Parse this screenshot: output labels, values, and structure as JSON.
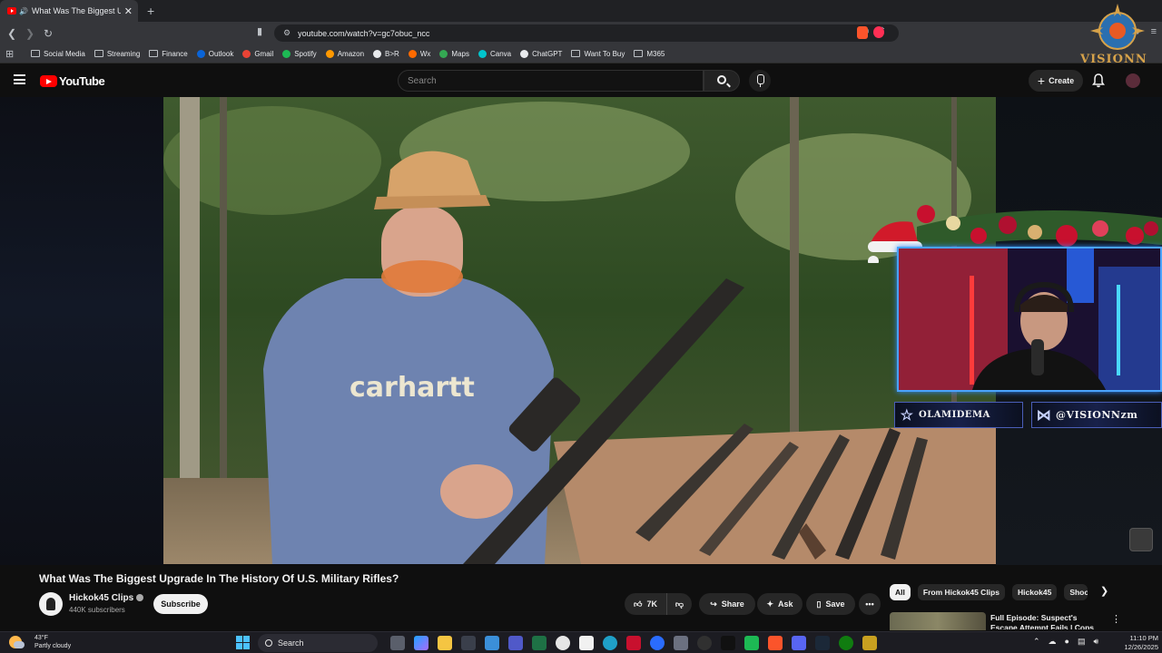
{
  "browser": {
    "tab_title": "What Was The Biggest Upgrade In The History Of U.S. Military Rifles?",
    "new_tab": "+",
    "url": "youtube.com/watch?v=gc7obuc_ncc",
    "bookmarks": [
      {
        "label": "Social Media",
        "icon": "folder-icon"
      },
      {
        "label": "Streaming",
        "icon": "folder-icon"
      },
      {
        "label": "Finance",
        "icon": "folder-icon"
      },
      {
        "label": "Outlook",
        "icon": "outlook-icon",
        "color": "#0a64d8"
      },
      {
        "label": "Gmail",
        "icon": "gmail-icon",
        "color": "#ea4335"
      },
      {
        "label": "Spotify",
        "icon": "spotify-icon",
        "color": "#1db954"
      },
      {
        "label": "Amazon",
        "icon": "amazon-icon",
        "color": "#ff9900"
      },
      {
        "label": "B>R",
        "icon": "br-icon",
        "color": "#e8eaed"
      },
      {
        "label": "Wx",
        "icon": "weather-icon",
        "color": "#ff6a00"
      },
      {
        "label": "Maps",
        "icon": "maps-icon",
        "color": "#34a853"
      },
      {
        "label": "Canva",
        "icon": "canva-icon",
        "color": "#00c4cc"
      },
      {
        "label": "ChatGPT",
        "icon": "chatgpt-icon",
        "color": "#e8eaed"
      },
      {
        "label": "Want To Buy",
        "icon": "folder-icon"
      },
      {
        "label": "M365",
        "icon": "folder-icon"
      }
    ],
    "extension_badge": "8"
  },
  "youtube": {
    "logo_text": "YouTube",
    "search_placeholder": "Search",
    "create_label": "Create",
    "video_title": "What Was The Biggest Upgrade In The History Of U.S. Military Rifles?",
    "channel_name": "Hickok45 Clips",
    "subscribers": "440K subscribers",
    "subscribe_label": "Subscribe",
    "likes": "7K",
    "share_label": "Share",
    "ask_label": "Ask",
    "save_label": "Save",
    "chips": [
      "All",
      "From Hickok45 Clips",
      "Hickok45",
      "Shoo"
    ],
    "recommended": {
      "title": "Full Episode: Suspect's Escape Attempt Fails | Cops TV Show"
    }
  },
  "overlay": {
    "logo_text": "VISIONN",
    "name_left": "OLAMIDEMA",
    "name_right": "@VISIONNzm",
    "shirt_text": "carhartt"
  },
  "taskbar": {
    "temp": "43°F",
    "weather": "Partly cloudy",
    "search_label": "Search",
    "time": "11:10 PM",
    "date": "12/26/2025"
  },
  "colors": {
    "youtube_red": "#ff0000",
    "cam_border": "#4aa3ff",
    "win_accent": "#4cc2ff"
  }
}
